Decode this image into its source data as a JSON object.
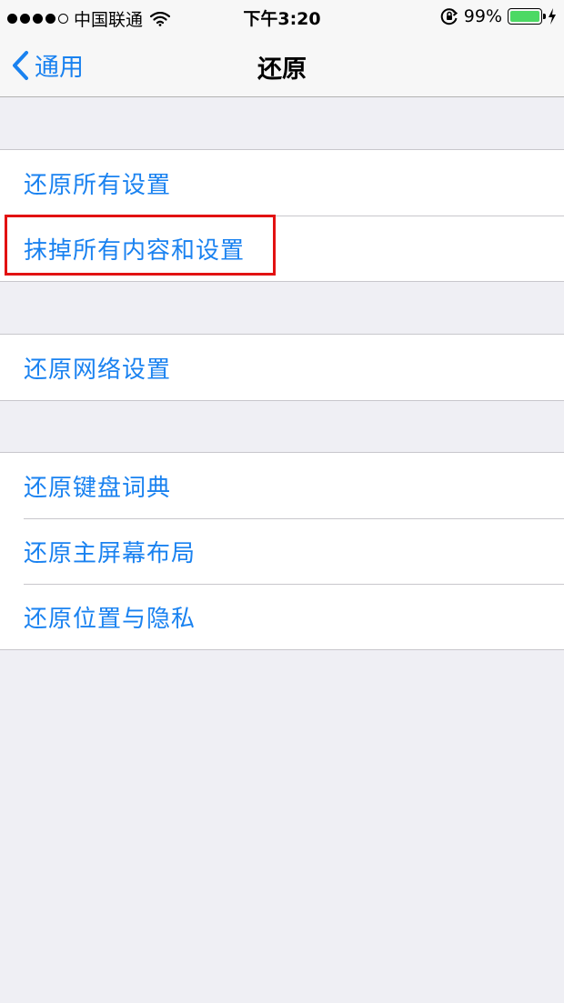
{
  "status_bar": {
    "carrier": "中国联通",
    "time": "下午3:20",
    "battery_percent": "99%",
    "battery_level": 0.99
  },
  "nav": {
    "back_label": "通用",
    "title": "还原"
  },
  "groups": [
    {
      "items": [
        {
          "label": "还原所有设置"
        },
        {
          "label": "抹掉所有内容和设置"
        }
      ]
    },
    {
      "items": [
        {
          "label": "还原网络设置"
        }
      ]
    },
    {
      "items": [
        {
          "label": "还原键盘词典"
        },
        {
          "label": "还原主屏幕布局"
        },
        {
          "label": "还原位置与隐私"
        }
      ]
    }
  ],
  "colors": {
    "accent": "#1a82f0",
    "highlight": "#e21212",
    "battery_fill": "#4cd964",
    "background": "#efeff4"
  },
  "icons": [
    "signal-dots-icon",
    "wifi-icon",
    "rotation-lock-icon",
    "battery-icon",
    "charging-bolt-icon",
    "chevron-left-icon"
  ]
}
